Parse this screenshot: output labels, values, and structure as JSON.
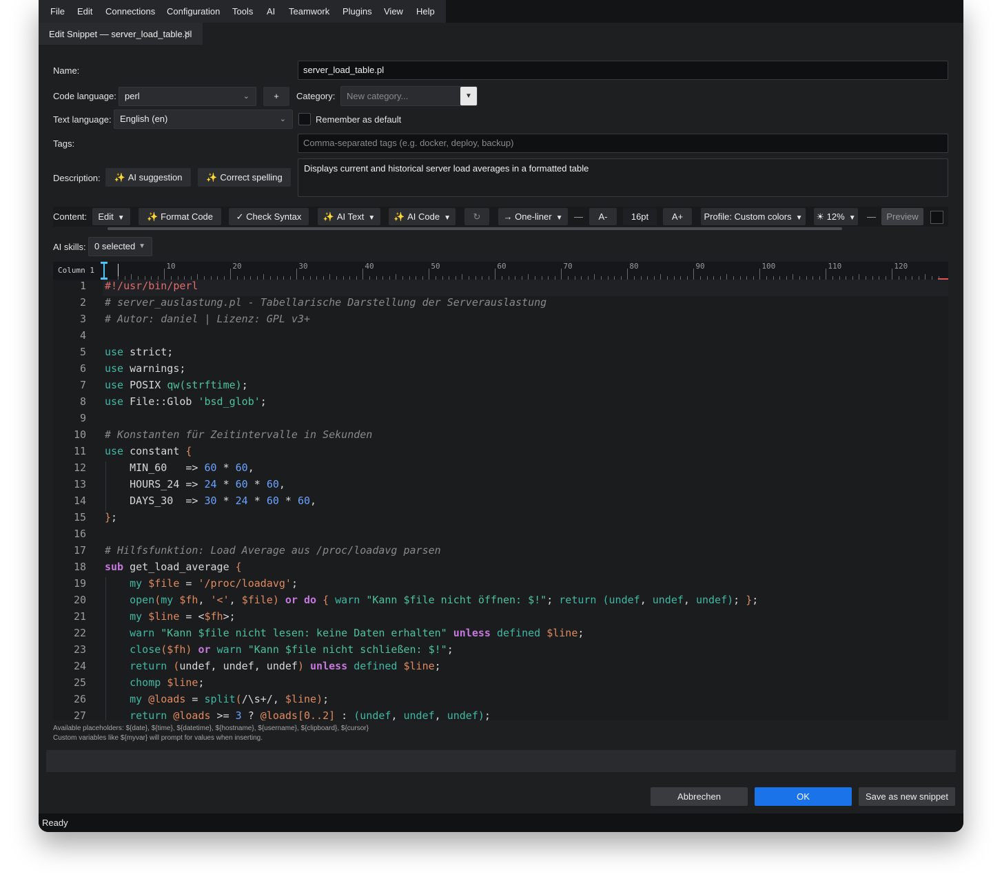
{
  "menu": [
    "File",
    "Edit",
    "Connections",
    "Configuration",
    "Tools",
    "AI",
    "Teamwork",
    "Plugins",
    "View",
    "Help"
  ],
  "tab": {
    "title": "Edit Snippet — server_load_table.pl",
    "close": "✕"
  },
  "form": {
    "name_label": "Name:",
    "name_value": "server_load_table.pl",
    "code_language_label": "Code language:",
    "code_language_value": "perl",
    "add_label": "+",
    "category_label": "Category:",
    "category_placeholder": "New category...",
    "text_language_label": "Text language:",
    "text_language_value": "English (en)",
    "remember_label": "Remember as default",
    "tags_label": "Tags:",
    "tags_placeholder": "Comma-separated tags (e.g. docker, deploy, backup)",
    "description_label": "Description:",
    "ai_suggestion": "AI suggestion",
    "correct_spelling": "Correct spelling",
    "description_value": "Displays current and historical server load averages in a formatted table"
  },
  "toolbar": {
    "content_label": "Content:",
    "edit": "Edit",
    "format_code": "Format Code",
    "check_syntax": "✓ Check Syntax",
    "ai_text": "AI Text",
    "ai_code": "AI Code",
    "refresh": "↻",
    "one_liner": "→ One-liner",
    "font_smaller": "A-",
    "font_size": "16pt",
    "font_larger": "A+",
    "profile": "Profile: Custom colors",
    "brightness": "☀ 12%",
    "preview": "Preview"
  },
  "ai_skills": {
    "label": "AI skills:",
    "value": "0 selected"
  },
  "ruler": {
    "label": "Column 1",
    "marks": [
      "10",
      "20",
      "30",
      "40",
      "50",
      "60",
      "70",
      "80",
      "90",
      "100",
      "110",
      "120"
    ]
  },
  "code_lines": [
    [
      [
        "sh",
        "#!/usr/bin/perl"
      ]
    ],
    [
      [
        "cm",
        "# server_auslastung.pl - Tabellarische Darstellung der Serverauslastung"
      ]
    ],
    [
      [
        "cm",
        "# Autor: daniel | Lizenz: GPL v3+"
      ]
    ],
    [],
    [
      [
        "kw",
        "use"
      ],
      [
        "tx",
        " strict;"
      ]
    ],
    [
      [
        "kw",
        "use"
      ],
      [
        "tx",
        " warnings;"
      ]
    ],
    [
      [
        "kw",
        "use"
      ],
      [
        "tx",
        " POSIX "
      ],
      [
        "st",
        "qw(strftime)"
      ],
      [
        "tx",
        ";"
      ]
    ],
    [
      [
        "kw",
        "use"
      ],
      [
        "tx",
        " File::Glob "
      ],
      [
        "st",
        "'bsd_glob'"
      ],
      [
        "tx",
        ";"
      ]
    ],
    [],
    [
      [
        "cm",
        "# Konstanten für Zeitintervalle in Sekunden"
      ]
    ],
    [
      [
        "kw",
        "use"
      ],
      [
        "tx",
        " constant "
      ],
      [
        "var",
        "{"
      ]
    ],
    [
      [
        "tx",
        "    MIN_60   => "
      ],
      [
        "nm",
        "60"
      ],
      [
        "tx",
        " * "
      ],
      [
        "nm",
        "60"
      ],
      [
        "tx",
        ","
      ]
    ],
    [
      [
        "tx",
        "    HOURS_24 => "
      ],
      [
        "nm",
        "24"
      ],
      [
        "tx",
        " * "
      ],
      [
        "nm",
        "60"
      ],
      [
        "tx",
        " * "
      ],
      [
        "nm",
        "60"
      ],
      [
        "tx",
        ","
      ]
    ],
    [
      [
        "tx",
        "    DAYS_30  => "
      ],
      [
        "nm",
        "30"
      ],
      [
        "tx",
        " * "
      ],
      [
        "nm",
        "24"
      ],
      [
        "tx",
        " * "
      ],
      [
        "nm",
        "60"
      ],
      [
        "tx",
        " * "
      ],
      [
        "nm",
        "60"
      ],
      [
        "tx",
        ","
      ]
    ],
    [
      [
        "var",
        "}"
      ],
      [
        "tx",
        ";"
      ]
    ],
    [],
    [
      [
        "cm",
        "# Hilfsfunktion: Load Average aus /proc/loadavg parsen"
      ]
    ],
    [
      [
        "op",
        "sub"
      ],
      [
        "tx",
        " get_load_average "
      ],
      [
        "var",
        "{"
      ]
    ],
    [
      [
        "tx",
        "    "
      ],
      [
        "kw",
        "my"
      ],
      [
        "tx",
        " "
      ],
      [
        "var",
        "$file"
      ],
      [
        "tx",
        " = "
      ],
      [
        "var",
        "'/proc/loadavg'"
      ],
      [
        "tx",
        ";"
      ]
    ],
    [
      [
        "tx",
        "    "
      ],
      [
        "fn",
        "open"
      ],
      [
        "var",
        "("
      ],
      [
        "kw",
        "my"
      ],
      [
        "tx",
        " "
      ],
      [
        "var",
        "$fh"
      ],
      [
        "tx",
        ", "
      ],
      [
        "var",
        "'<'"
      ],
      [
        "tx",
        ", "
      ],
      [
        "var",
        "$file"
      ],
      [
        "var",
        ")"
      ],
      [
        "tx",
        " "
      ],
      [
        "op",
        "or"
      ],
      [
        "tx",
        " "
      ],
      [
        "op",
        "do"
      ],
      [
        "tx",
        " "
      ],
      [
        "var",
        "{"
      ],
      [
        "tx",
        " "
      ],
      [
        "kw",
        "warn"
      ],
      [
        "tx",
        " "
      ],
      [
        "st",
        "\"Kann $file nicht öffnen: $!\""
      ],
      [
        "tx",
        "; "
      ],
      [
        "kw",
        "return"
      ],
      [
        "tx",
        " "
      ],
      [
        "kw",
        "(undef"
      ],
      [
        "tx",
        ", "
      ],
      [
        "kw",
        "undef"
      ],
      [
        "tx",
        ", "
      ],
      [
        "kw",
        "undef)"
      ],
      [
        "tx",
        "; "
      ],
      [
        "var",
        "}"
      ],
      [
        "tx",
        ";"
      ]
    ],
    [
      [
        "tx",
        "    "
      ],
      [
        "kw",
        "my"
      ],
      [
        "tx",
        " "
      ],
      [
        "var",
        "$line"
      ],
      [
        "tx",
        " = <"
      ],
      [
        "var",
        "$fh"
      ],
      [
        "tx",
        ">;"
      ]
    ],
    [
      [
        "tx",
        "    "
      ],
      [
        "kw",
        "warn"
      ],
      [
        "tx",
        " "
      ],
      [
        "st",
        "\"Kann $file nicht lesen: keine Daten erhalten\""
      ],
      [
        "tx",
        " "
      ],
      [
        "op",
        "unless"
      ],
      [
        "tx",
        " "
      ],
      [
        "kw",
        "defined"
      ],
      [
        "tx",
        " "
      ],
      [
        "var",
        "$line"
      ],
      [
        "tx",
        ";"
      ]
    ],
    [
      [
        "tx",
        "    "
      ],
      [
        "fn",
        "close"
      ],
      [
        "var",
        "($fh)"
      ],
      [
        "tx",
        " "
      ],
      [
        "op",
        "or"
      ],
      [
        "tx",
        " "
      ],
      [
        "kw",
        "warn"
      ],
      [
        "tx",
        " "
      ],
      [
        "st",
        "\"Kann $file nicht schließen: $!\""
      ],
      [
        "tx",
        ";"
      ]
    ],
    [
      [
        "tx",
        "    "
      ],
      [
        "kw",
        "return"
      ],
      [
        "tx",
        " "
      ],
      [
        "var",
        "("
      ],
      [
        "tx",
        "undef, undef, undef"
      ],
      [
        "var",
        ")"
      ],
      [
        "tx",
        " "
      ],
      [
        "op",
        "unless"
      ],
      [
        "tx",
        " "
      ],
      [
        "kw",
        "defined"
      ],
      [
        "tx",
        " "
      ],
      [
        "var",
        "$line"
      ],
      [
        "tx",
        ";"
      ]
    ],
    [
      [
        "tx",
        "    "
      ],
      [
        "fn",
        "chomp"
      ],
      [
        "tx",
        " "
      ],
      [
        "var",
        "$line"
      ],
      [
        "tx",
        ";"
      ]
    ],
    [
      [
        "tx",
        "    "
      ],
      [
        "kw",
        "my"
      ],
      [
        "tx",
        " "
      ],
      [
        "var",
        "@loads"
      ],
      [
        "tx",
        " = "
      ],
      [
        "fn",
        "split"
      ],
      [
        "var",
        "("
      ],
      [
        "tx",
        "/\\s+/, "
      ],
      [
        "var",
        "$line"
      ],
      [
        "var",
        ")"
      ],
      [
        "tx",
        ";"
      ]
    ],
    [
      [
        "tx",
        "    "
      ],
      [
        "kw",
        "return"
      ],
      [
        "tx",
        " "
      ],
      [
        "var",
        "@loads"
      ],
      [
        "tx",
        " >= "
      ],
      [
        "nm",
        "3"
      ],
      [
        "tx",
        " ? "
      ],
      [
        "var",
        "@loads[0..2]"
      ],
      [
        "tx",
        " : "
      ],
      [
        "kw",
        "(undef"
      ],
      [
        "tx",
        ", "
      ],
      [
        "kw",
        "undef"
      ],
      [
        "tx",
        ", "
      ],
      [
        "kw",
        "undef)"
      ],
      [
        "tx",
        ";"
      ]
    ]
  ],
  "hints": [
    "Available placeholders: ${date}, ${time}, ${datetime}, ${hostname}, ${username}, ${clipboard}, ${cursor}",
    "Custom variables like ${myvar} will prompt for values when inserting."
  ],
  "buttons": {
    "cancel": "Abbrechen",
    "ok": "OK",
    "save_new": "Save as new snippet"
  },
  "status": "Ready",
  "colors": {
    "accent": "#1a73e8",
    "window_bg": "#1e1f21",
    "editor_bg": "#1b1c1e"
  }
}
